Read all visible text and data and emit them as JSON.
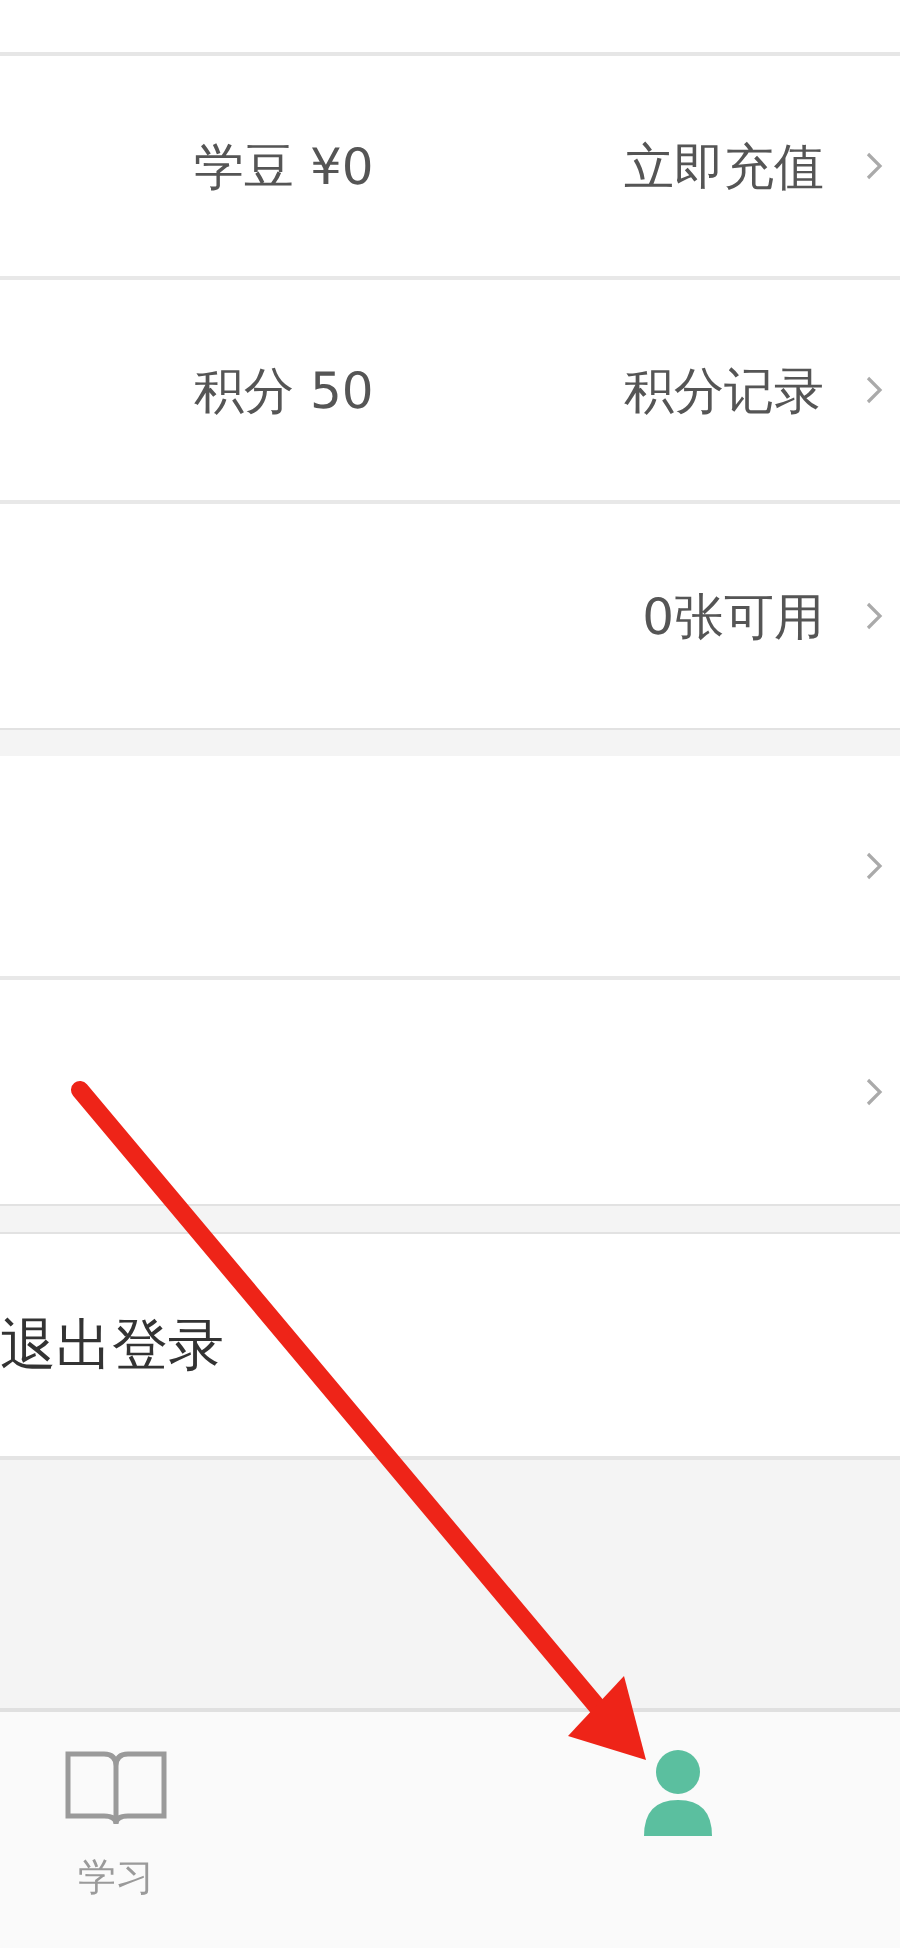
{
  "sections": [
    {
      "rows": [
        {
          "kind": "link",
          "value": "学豆 ¥0",
          "action": "立即充值"
        },
        {
          "kind": "link",
          "value": "积分 50",
          "action": "积分记录"
        },
        {
          "kind": "link",
          "action": "0张可用"
        }
      ]
    },
    {
      "rows": [
        {
          "kind": "link"
        },
        {
          "kind": "link"
        }
      ]
    }
  ],
  "logout": {
    "label": "退出登录"
  },
  "tab_bar": [
    {
      "kind": "book",
      "label": "学习",
      "selected": false
    },
    {
      "kind": "person",
      "selected": true
    }
  ]
}
